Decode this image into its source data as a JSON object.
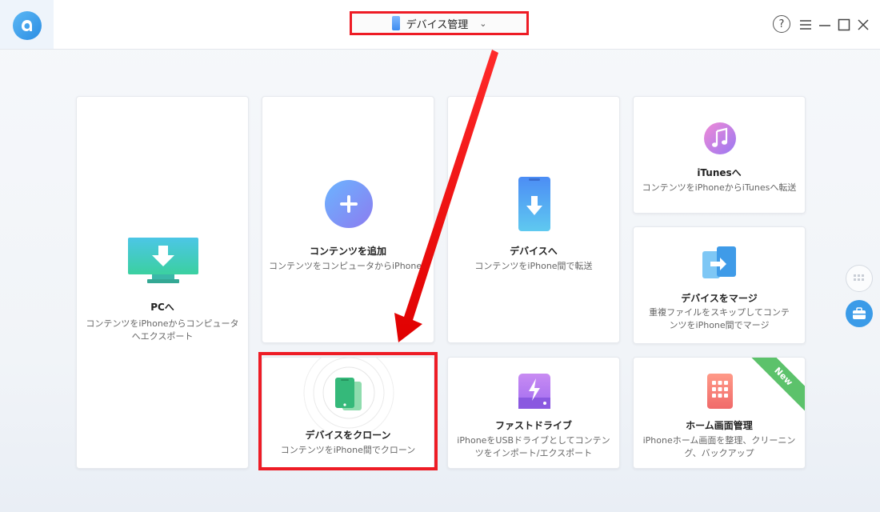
{
  "titlebar": {
    "device_label": "デバイス管理",
    "help_label": "?"
  },
  "cards": {
    "pc": {
      "title": "PCへ",
      "desc": "コンテンツをiPhoneからコンピュータへエクスポート"
    },
    "add": {
      "title": "コンテンツを追加",
      "desc": "コンテンツをコンピュータからiPhoneへ追加"
    },
    "device": {
      "title": "デバイスへ",
      "desc": "コンテンツをiPhone間で転送"
    },
    "itunes": {
      "title": "iTunesへ",
      "desc": "コンテンツをiPhoneからiTunesへ転送"
    },
    "merge": {
      "title": "デバイスをマージ",
      "desc": "重複ファイルをスキップしてコンテンツをiPhone間でマージ"
    },
    "clone": {
      "title": "デバイスをクローン",
      "desc": "コンテンツをiPhone間でクローン"
    },
    "fastdrive": {
      "title": "ファストドライブ",
      "desc": "iPhoneをUSBドライブとしてコンテンツをインポート/エクスポート"
    },
    "home": {
      "title": "ホーム画面管理",
      "desc": "iPhoneホーム画面を整理、クリーニング、バックアップ",
      "badge": "New"
    }
  },
  "colors": {
    "accent": "#2b8de3",
    "highlight": "#ee1c25",
    "new_badge": "#5cc26b"
  }
}
